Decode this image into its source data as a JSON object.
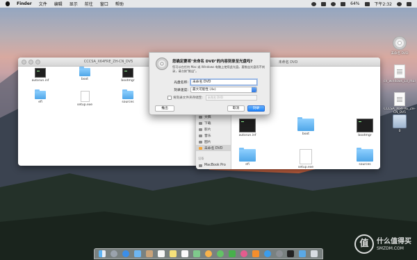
{
  "menubar": {
    "app": "Finder",
    "items": [
      "文件",
      "编辑",
      "显示",
      "前往",
      "窗口",
      "帮助"
    ],
    "battery": "64%",
    "time": "下午2:32"
  },
  "desktop": {
    "icons": [
      {
        "label": "未命名 DVD"
      },
      {
        "label": "cn_windows_10_multiple_edition_x64_dvd_6848463.iso"
      },
      {
        "label": "CCCSA_X64FRE_ZH-CN_DV5"
      },
      {
        "label": "0"
      }
    ]
  },
  "left_window": {
    "title": "CCCSA_X64FRE_ZH-CN_DV5",
    "items": [
      {
        "label": "autorun.inf",
        "kind": "term"
      },
      {
        "label": "boot",
        "kind": "folder"
      },
      {
        "label": "bootmgr",
        "kind": "term"
      },
      {
        "label": "efi",
        "kind": "folder"
      },
      {
        "label": "setup.exe",
        "kind": "doc"
      },
      {
        "label": "sources",
        "kind": "folder"
      }
    ]
  },
  "right_window": {
    "title": "未命名 DVD",
    "sidebar": {
      "items": [
        "文稿",
        "下载",
        "影片",
        "音乐",
        "图片"
      ],
      "selected": "未命名 DVD",
      "devices_heading": "设备",
      "device": "MacBook Pro"
    },
    "items": [
      {
        "label": "autorun.inf",
        "kind": "term"
      },
      {
        "label": "boot",
        "kind": "folder"
      },
      {
        "label": "bootmgr",
        "kind": "term"
      },
      {
        "label": "efi",
        "kind": "folder"
      },
      {
        "label": "setup.exe",
        "kind": "doc"
      },
      {
        "label": "sources",
        "kind": "folder"
      }
    ]
  },
  "burn_sheet": {
    "message": "您确定要将\"未命名 DVD\"的内容刻录至光盘吗?",
    "sub": "您可以在任何 Mac 或 Windows 电脑上使用此光盘。要推出光盘而不刻录，请点按\"推出\"。",
    "disc_name_label": "光盘名称:",
    "disc_name_value": "未命名 DVD",
    "speed_label": "刻录速度:",
    "speed_value": "最大可能性 (4x)",
    "save_folder_label": "将刻录文件夹存储至:",
    "save_folder_value": "未命名 DVD",
    "eject_button": "推出",
    "cancel_button": "取消",
    "burn_button": "刻录"
  },
  "watermark": {
    "glyph": "值",
    "text": "什么值得买",
    "sub": "SMZDM.COM"
  }
}
